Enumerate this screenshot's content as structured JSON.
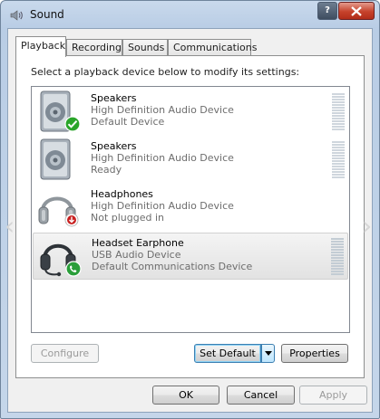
{
  "window": {
    "title": "Sound"
  },
  "tabs": [
    {
      "label": "Playback",
      "active": true
    },
    {
      "label": "Recording",
      "active": false
    },
    {
      "label": "Sounds",
      "active": false
    },
    {
      "label": "Communications",
      "active": false
    }
  ],
  "instruction": "Select a playback device below to modify its settings:",
  "devices": [
    {
      "name": "Speakers",
      "line1": "High Definition Audio Device",
      "line2": "Default Device",
      "icon": "speakers-icon",
      "status": "default-check-icon"
    },
    {
      "name": "Speakers",
      "line1": "High Definition Audio Device",
      "line2": "Ready",
      "icon": "speakers-icon",
      "status": "none"
    },
    {
      "name": "Headphones",
      "line1": "High Definition Audio Device",
      "line2": "Not plugged in",
      "icon": "headphones-icon",
      "status": "unplugged-icon"
    },
    {
      "name": "Headset Earphone",
      "line1": "USB Audio Device",
      "line2": "Default Communications Device",
      "icon": "headset-icon",
      "status": "phone-icon",
      "selected": true
    }
  ],
  "buttons": {
    "configure": "Configure",
    "set_default": "Set Default",
    "properties": "Properties",
    "ok": "OK",
    "cancel": "Cancel",
    "apply": "Apply"
  },
  "colors": {
    "check": "#2aa52a",
    "unplugged": "#c82020",
    "phone": "#2a9e3a"
  }
}
